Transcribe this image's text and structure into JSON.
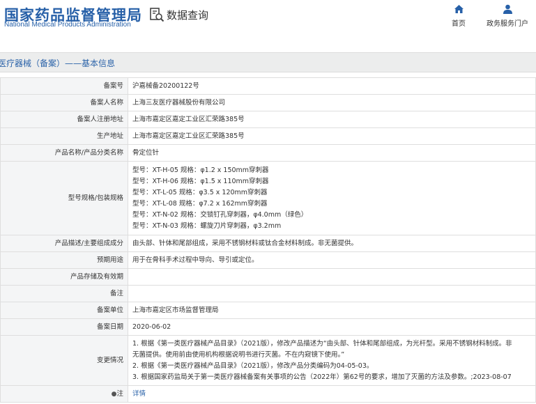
{
  "header": {
    "logo_cn": "国家药品监督管理局",
    "logo_en": "National Medical Products Administration",
    "query_label": "数据查询",
    "nav": [
      {
        "label": "首页",
        "icon": "home-icon"
      },
      {
        "label": "政务服务门户",
        "icon": "user-icon"
      }
    ]
  },
  "section_title": "医疗器械（备案）——基本信息",
  "rows": [
    {
      "label": "备案号",
      "value": "沪嘉械备20200122号"
    },
    {
      "label": "备案人名称",
      "value": "上海三友医疗器械股份有限公司"
    },
    {
      "label": "备案人注册地址",
      "value": "上海市嘉定区嘉定工业区汇荣路385号"
    },
    {
      "label": "生产地址",
      "value": "上海市嘉定区嘉定工业区汇荣路385号"
    },
    {
      "label": "产品名称/产品分类名称",
      "value": "骨定位针"
    },
    {
      "label": "型号规格/包装规格",
      "lines": [
        "型号：XT-H-05 规格：φ1.2 x 150mm穿刺器",
        "型号：XT-H-06 规格：φ1.5 x 110mm穿刺器",
        "型号：XT-L-05 规格：φ3.5 x 120mm穿刺器",
        "型号：XT-L-08 规格：φ7.2 x 162mm穿刺器",
        "型号：XT-N-02 规格：交锁钉孔穿刺器，φ4.0mm（绿色）",
        "型号：XT-N-03 规格：螺旋刀片穿刺器，φ3.2mm"
      ]
    },
    {
      "label": "产品描述/主要组成成分",
      "value": "由头部、针体和尾部组成，采用不锈钢材料或钛合金材料制成。非无菌提供。"
    },
    {
      "label": "预期用途",
      "value": "用于在骨科手术过程中导向、导引或定位。"
    },
    {
      "label": "产品存储及有效期",
      "value": ""
    },
    {
      "label": "备注",
      "value": ""
    },
    {
      "label": "备案单位",
      "value": "上海市嘉定区市场监督管理局"
    },
    {
      "label": "备案日期",
      "value": "2020-06-02"
    },
    {
      "label": "变更情况",
      "lines": [
        "1. 根据《第一类医疗器械产品目录》（2021版），修改产品描述为“由头部、针体和尾部组成，为光杆型。采用不锈钢材料制成。非",
        "无菌提供。使用前由使用机构根据说明书进行灭菌。不在内窥镜下使用。”",
        "2. 根据《第一类医疗器械产品目录》（2021版），修改产品分类编码为04-05-03。",
        "3. 根据国家药监局关于第一类医疗器械备案有关事项的公告（2022年）第62号的要求，增加了灭菌的方法及参数。;2023-08-07"
      ]
    },
    {
      "label": "注",
      "value": "详情"
    }
  ]
}
